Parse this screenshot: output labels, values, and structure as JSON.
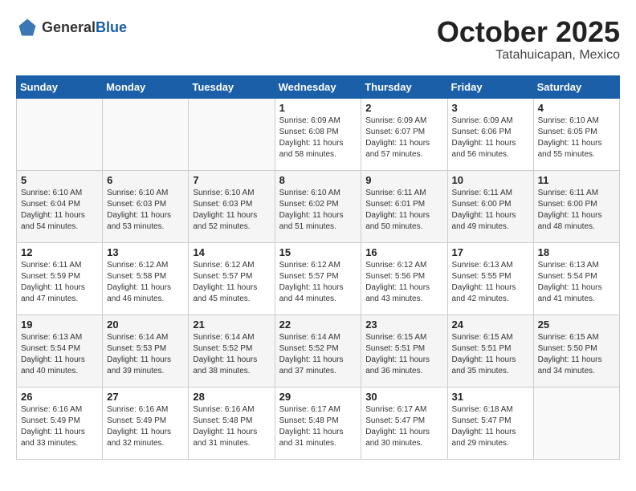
{
  "header": {
    "logo_general": "General",
    "logo_blue": "Blue",
    "month": "October 2025",
    "location": "Tatahuicapan, Mexico"
  },
  "weekdays": [
    "Sunday",
    "Monday",
    "Tuesday",
    "Wednesday",
    "Thursday",
    "Friday",
    "Saturday"
  ],
  "weeks": [
    [
      {
        "day": "",
        "sunrise": "",
        "sunset": "",
        "daylight": ""
      },
      {
        "day": "",
        "sunrise": "",
        "sunset": "",
        "daylight": ""
      },
      {
        "day": "",
        "sunrise": "",
        "sunset": "",
        "daylight": ""
      },
      {
        "day": "1",
        "sunrise": "Sunrise: 6:09 AM",
        "sunset": "Sunset: 6:08 PM",
        "daylight": "Daylight: 11 hours and 58 minutes."
      },
      {
        "day": "2",
        "sunrise": "Sunrise: 6:09 AM",
        "sunset": "Sunset: 6:07 PM",
        "daylight": "Daylight: 11 hours and 57 minutes."
      },
      {
        "day": "3",
        "sunrise": "Sunrise: 6:09 AM",
        "sunset": "Sunset: 6:06 PM",
        "daylight": "Daylight: 11 hours and 56 minutes."
      },
      {
        "day": "4",
        "sunrise": "Sunrise: 6:10 AM",
        "sunset": "Sunset: 6:05 PM",
        "daylight": "Daylight: 11 hours and 55 minutes."
      }
    ],
    [
      {
        "day": "5",
        "sunrise": "Sunrise: 6:10 AM",
        "sunset": "Sunset: 6:04 PM",
        "daylight": "Daylight: 11 hours and 54 minutes."
      },
      {
        "day": "6",
        "sunrise": "Sunrise: 6:10 AM",
        "sunset": "Sunset: 6:03 PM",
        "daylight": "Daylight: 11 hours and 53 minutes."
      },
      {
        "day": "7",
        "sunrise": "Sunrise: 6:10 AM",
        "sunset": "Sunset: 6:03 PM",
        "daylight": "Daylight: 11 hours and 52 minutes."
      },
      {
        "day": "8",
        "sunrise": "Sunrise: 6:10 AM",
        "sunset": "Sunset: 6:02 PM",
        "daylight": "Daylight: 11 hours and 51 minutes."
      },
      {
        "day": "9",
        "sunrise": "Sunrise: 6:11 AM",
        "sunset": "Sunset: 6:01 PM",
        "daylight": "Daylight: 11 hours and 50 minutes."
      },
      {
        "day": "10",
        "sunrise": "Sunrise: 6:11 AM",
        "sunset": "Sunset: 6:00 PM",
        "daylight": "Daylight: 11 hours and 49 minutes."
      },
      {
        "day": "11",
        "sunrise": "Sunrise: 6:11 AM",
        "sunset": "Sunset: 6:00 PM",
        "daylight": "Daylight: 11 hours and 48 minutes."
      }
    ],
    [
      {
        "day": "12",
        "sunrise": "Sunrise: 6:11 AM",
        "sunset": "Sunset: 5:59 PM",
        "daylight": "Daylight: 11 hours and 47 minutes."
      },
      {
        "day": "13",
        "sunrise": "Sunrise: 6:12 AM",
        "sunset": "Sunset: 5:58 PM",
        "daylight": "Daylight: 11 hours and 46 minutes."
      },
      {
        "day": "14",
        "sunrise": "Sunrise: 6:12 AM",
        "sunset": "Sunset: 5:57 PM",
        "daylight": "Daylight: 11 hours and 45 minutes."
      },
      {
        "day": "15",
        "sunrise": "Sunrise: 6:12 AM",
        "sunset": "Sunset: 5:57 PM",
        "daylight": "Daylight: 11 hours and 44 minutes."
      },
      {
        "day": "16",
        "sunrise": "Sunrise: 6:12 AM",
        "sunset": "Sunset: 5:56 PM",
        "daylight": "Daylight: 11 hours and 43 minutes."
      },
      {
        "day": "17",
        "sunrise": "Sunrise: 6:13 AM",
        "sunset": "Sunset: 5:55 PM",
        "daylight": "Daylight: 11 hours and 42 minutes."
      },
      {
        "day": "18",
        "sunrise": "Sunrise: 6:13 AM",
        "sunset": "Sunset: 5:54 PM",
        "daylight": "Daylight: 11 hours and 41 minutes."
      }
    ],
    [
      {
        "day": "19",
        "sunrise": "Sunrise: 6:13 AM",
        "sunset": "Sunset: 5:54 PM",
        "daylight": "Daylight: 11 hours and 40 minutes."
      },
      {
        "day": "20",
        "sunrise": "Sunrise: 6:14 AM",
        "sunset": "Sunset: 5:53 PM",
        "daylight": "Daylight: 11 hours and 39 minutes."
      },
      {
        "day": "21",
        "sunrise": "Sunrise: 6:14 AM",
        "sunset": "Sunset: 5:52 PM",
        "daylight": "Daylight: 11 hours and 38 minutes."
      },
      {
        "day": "22",
        "sunrise": "Sunrise: 6:14 AM",
        "sunset": "Sunset: 5:52 PM",
        "daylight": "Daylight: 11 hours and 37 minutes."
      },
      {
        "day": "23",
        "sunrise": "Sunrise: 6:15 AM",
        "sunset": "Sunset: 5:51 PM",
        "daylight": "Daylight: 11 hours and 36 minutes."
      },
      {
        "day": "24",
        "sunrise": "Sunrise: 6:15 AM",
        "sunset": "Sunset: 5:51 PM",
        "daylight": "Daylight: 11 hours and 35 minutes."
      },
      {
        "day": "25",
        "sunrise": "Sunrise: 6:15 AM",
        "sunset": "Sunset: 5:50 PM",
        "daylight": "Daylight: 11 hours and 34 minutes."
      }
    ],
    [
      {
        "day": "26",
        "sunrise": "Sunrise: 6:16 AM",
        "sunset": "Sunset: 5:49 PM",
        "daylight": "Daylight: 11 hours and 33 minutes."
      },
      {
        "day": "27",
        "sunrise": "Sunrise: 6:16 AM",
        "sunset": "Sunset: 5:49 PM",
        "daylight": "Daylight: 11 hours and 32 minutes."
      },
      {
        "day": "28",
        "sunrise": "Sunrise: 6:16 AM",
        "sunset": "Sunset: 5:48 PM",
        "daylight": "Daylight: 11 hours and 31 minutes."
      },
      {
        "day": "29",
        "sunrise": "Sunrise: 6:17 AM",
        "sunset": "Sunset: 5:48 PM",
        "daylight": "Daylight: 11 hours and 31 minutes."
      },
      {
        "day": "30",
        "sunrise": "Sunrise: 6:17 AM",
        "sunset": "Sunset: 5:47 PM",
        "daylight": "Daylight: 11 hours and 30 minutes."
      },
      {
        "day": "31",
        "sunrise": "Sunrise: 6:18 AM",
        "sunset": "Sunset: 5:47 PM",
        "daylight": "Daylight: 11 hours and 29 minutes."
      },
      {
        "day": "",
        "sunrise": "",
        "sunset": "",
        "daylight": ""
      }
    ]
  ]
}
